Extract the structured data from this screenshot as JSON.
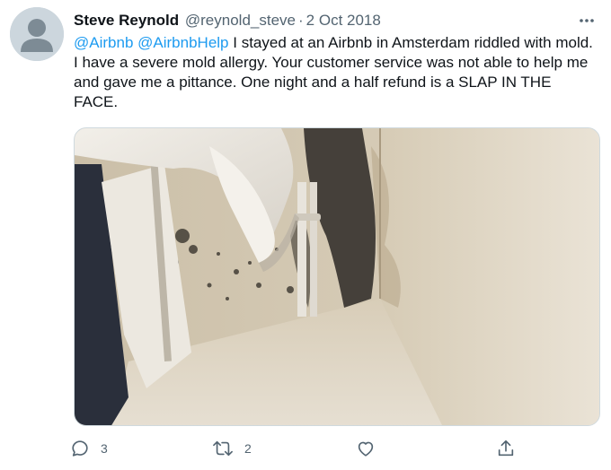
{
  "tweet": {
    "author_name": "Steve Reynold",
    "handle": "@reynold_steve",
    "separator": "·",
    "date": "2 Oct 2018",
    "mention_1": "@Airbnb",
    "mention_2": "@AirbnbHelp",
    "body": "I stayed at an Airbnb in Amsterdam riddled with mold. I have a severe mold allergy. Your customer service was not able to help me and gave me a pittance. One night and a half refund is a SLAP IN THE FACE.",
    "reply_count": "3",
    "retweet_count": "2",
    "like_count": "",
    "icons": {
      "avatar": "default-avatar-icon",
      "more": "more-options-icon",
      "reply": "reply-icon",
      "retweet": "retweet-icon",
      "like": "heart-icon",
      "share": "share-icon"
    }
  },
  "colors": {
    "link": "#1d9bf0",
    "secondary_text": "#536471",
    "avatar_bg": "#ccd6dd"
  }
}
